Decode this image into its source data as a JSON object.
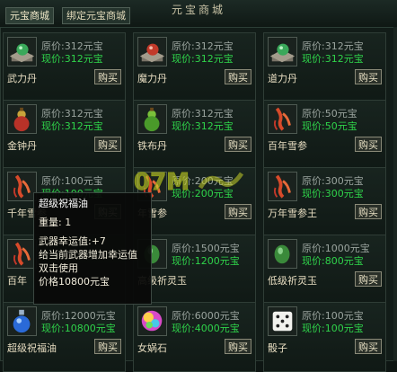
{
  "window": {
    "title": "元宝商城"
  },
  "tabs": [
    {
      "label": "元宝商城"
    },
    {
      "label": "绑定元宝商城"
    }
  ],
  "items": [
    {
      "name": "武力丹",
      "orig": "原价:312元宝",
      "now": "现价:312元宝",
      "buy": "购买",
      "icon": "green-orb-pedestal-icon"
    },
    {
      "name": "魔力丹",
      "orig": "原价:312元宝",
      "now": "现价:312元宝",
      "buy": "购买",
      "icon": "red-orb-pedestal-icon"
    },
    {
      "name": "道力丹",
      "orig": "原价:312元宝",
      "now": "现价:312元宝",
      "buy": "购买",
      "icon": "green-orb-pedestal-icon"
    },
    {
      "name": "金钟丹",
      "orig": "原价:312元宝",
      "now": "现价:312元宝",
      "buy": "购买",
      "icon": "gourd-red-icon"
    },
    {
      "name": "铁布丹",
      "orig": "原价:312元宝",
      "now": "现价:312元宝",
      "buy": "购买",
      "icon": "gourd-green-icon"
    },
    {
      "name": "百年雪参",
      "orig": "原价:50元宝",
      "now": "现价:50元宝",
      "buy": "购买",
      "icon": "ginseng-icon"
    },
    {
      "name": "千年雪参",
      "orig": "原价:100元宝",
      "now": "现价:100元宝",
      "buy": "购买",
      "icon": "ginseng-icon"
    },
    {
      "name": "年雪参",
      "orig": "原价:200元宝",
      "now": "现价:200元宝",
      "buy": "购买",
      "icon": "ginseng-icon"
    },
    {
      "name": "万年雪参王",
      "orig": "原价:300元宝",
      "now": "现价:300元宝",
      "buy": "购买",
      "icon": "ginseng-icon"
    },
    {
      "name": "百年",
      "orig": "",
      "now": "",
      "buy": "",
      "icon": "ginseng-icon"
    },
    {
      "name": "高级祈灵玉",
      "orig": "原价:1500元宝",
      "now": "现价:1200元宝",
      "buy": "",
      "icon": "jade-icon"
    },
    {
      "name": "低级祈灵玉",
      "orig": "原价:1000元宝",
      "now": "现价:800元宝",
      "buy": "购买",
      "icon": "jade-icon"
    },
    {
      "name": "超级祝福油",
      "orig": "原价:12000元宝",
      "now": "现价:10800元宝",
      "buy": "购买",
      "icon": "blue-potion-icon"
    },
    {
      "name": "女娲石",
      "orig": "原价:6000元宝",
      "now": "现价:4000元宝",
      "buy": "购买",
      "icon": "rainbow-stone-icon"
    },
    {
      "name": "骰子",
      "orig": "原价:100元宝",
      "now": "现价:100元宝",
      "buy": "购买",
      "icon": "dice-icon"
    }
  ],
  "tooltip": {
    "title": "超级祝福油",
    "weight": "重量: 1",
    "line1": "武器幸运值:+7",
    "line2": "给当前武器增加幸运值",
    "line3": "双击使用",
    "line4": "价格10800元宝"
  },
  "watermark": {
    "text": "07M"
  }
}
